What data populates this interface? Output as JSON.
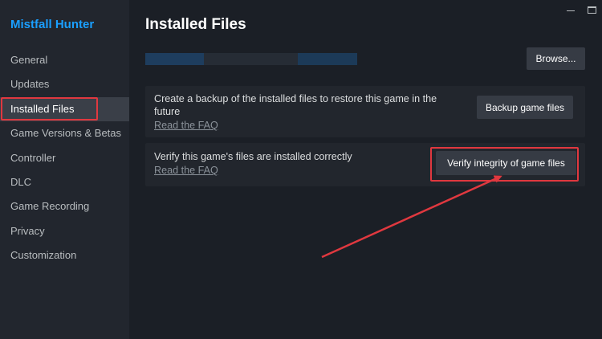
{
  "app": {
    "title": "Mistfall Hunter"
  },
  "sidebar": {
    "items": [
      {
        "label": "General"
      },
      {
        "label": "Updates"
      },
      {
        "label": "Installed Files"
      },
      {
        "label": "Game Versions & Betas"
      },
      {
        "label": "Controller"
      },
      {
        "label": "DLC"
      },
      {
        "label": "Game Recording"
      },
      {
        "label": "Privacy"
      },
      {
        "label": "Customization"
      }
    ],
    "active_index": 2
  },
  "window_controls": {
    "minimize_icon": "minimize-icon",
    "maximize_icon": "maximize-icon"
  },
  "main": {
    "title": "Installed Files",
    "browse_label": "Browse...",
    "backup": {
      "text": "Create a backup of the installed files to restore this game in the future",
      "link": "Read the FAQ",
      "button": "Backup game files"
    },
    "verify": {
      "text": "Verify this game's files are installed correctly",
      "link": "Read the FAQ",
      "button": "Verify integrity of game files"
    }
  },
  "colors": {
    "accent": "#1a9fff",
    "highlight": "#e0383f",
    "background": "#1b1f26",
    "sidebar": "#22262e"
  }
}
